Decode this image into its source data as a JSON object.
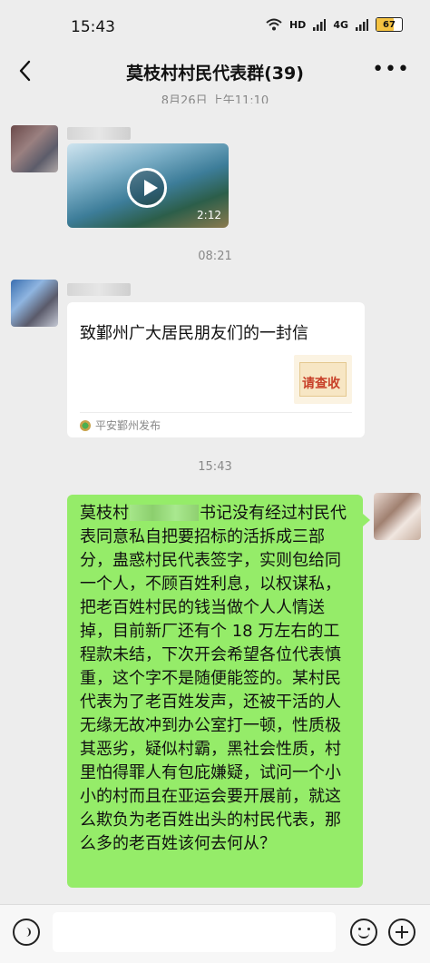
{
  "status_bar": {
    "time": "15:43",
    "battery": "67",
    "network": "4G"
  },
  "header": {
    "title": "莫枝村村民代表群(39)"
  },
  "timestamps": {
    "top_partial": "8月26日 上午11:10",
    "middle": "08:21",
    "bottom": "15:43"
  },
  "video_message": {
    "duration": "2:12"
  },
  "link_card": {
    "title": "致鄞州广大居民朋友们的一封信",
    "thumb_text": "请查收",
    "source": "平安鄞州发布"
  },
  "sent_message": {
    "prefix": "莫枝村",
    "body": "书记没有经过村民代表同意私自把要招标的活拆成三部分，蛊惑村民代表签字，实则包给同一个人，不顾百姓利息，以权谋私，把老百姓村民的钱当做个人人情送掉，目前新厂还有个 18 万左右的工程款未结，下次开会希望各位代表慎重，这个字不是随便能签的。某村民代表为了老百姓发声，还被干活的人无缘无故冲到办公室打一顿，性质极其恶劣，疑似村霸，黑社会性质，村里怕得罪人有包庇嫌疑，试问一个小小的村而且在亚运会要开展前，就这么欺负为老百姓出头的村民代表，那么多的老百姓该何去何从？"
  }
}
